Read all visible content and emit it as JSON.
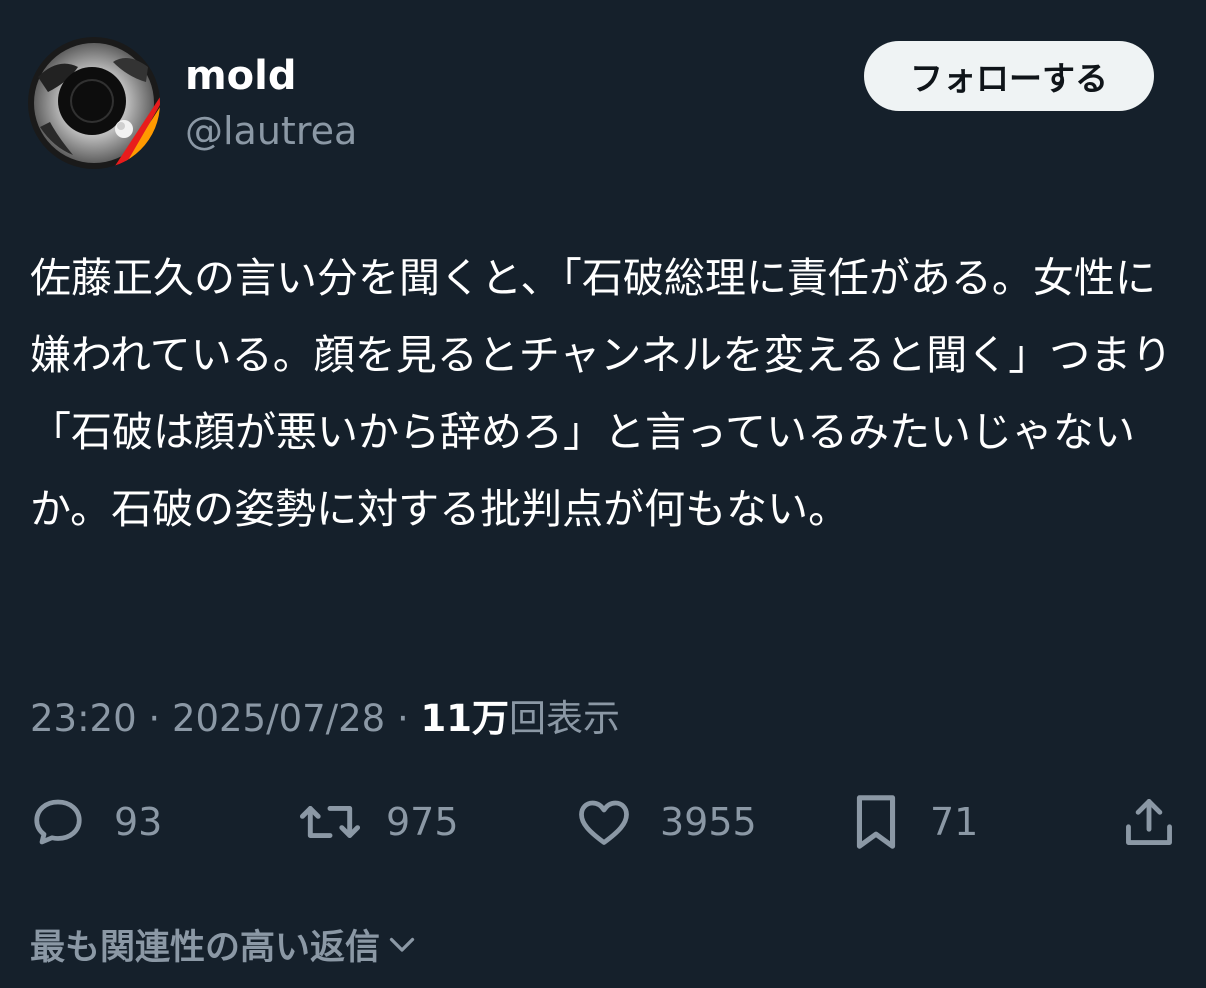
{
  "user": {
    "display_name": "mold",
    "handle": "@lautrea"
  },
  "follow_button": {
    "label": "フォローする"
  },
  "tweet": {
    "text": "佐藤正久の言い分を聞くと、「石破総理に責任がある。女性に嫌われている。顔を見るとチャンネルを変えると聞く」つまり「石破は顔が悪いから辞めろ」と言っているみたいじゃないか。石破の姿勢に対する批判点が何もない。"
  },
  "meta": {
    "time": "23:20",
    "separator": "·",
    "date": "2025/07/28",
    "views_count": "11万",
    "views_label": "回表示"
  },
  "actions": {
    "reply": {
      "icon": "reply-icon",
      "count": "93"
    },
    "retweet": {
      "icon": "retweet-icon",
      "count": "975"
    },
    "like": {
      "icon": "heart-icon",
      "count": "3955"
    },
    "bookmark": {
      "icon": "bookmark-icon",
      "count": "71"
    },
    "share": {
      "icon": "share-icon"
    }
  },
  "replies_sort": {
    "label": "最も関連性の高い返信",
    "icon": "chevron-down-icon"
  },
  "colors": {
    "background": "#15202b",
    "text_primary": "#ffffff",
    "text_secondary": "#8b98a5",
    "follow_bg": "#eff3f4"
  }
}
